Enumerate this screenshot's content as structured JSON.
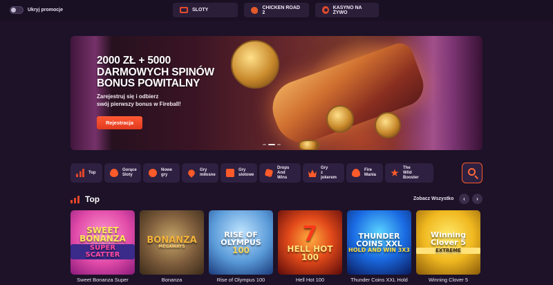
{
  "topbar": {
    "hide_promos_label": "Ukryj promocje",
    "tabs": [
      {
        "label": "SLOTY",
        "icon": "slot-machine-icon"
      },
      {
        "label": "CHICKEN ROAD 2",
        "icon": "chicken-icon"
      },
      {
        "label": "KASYNO NA ŻYWO",
        "icon": "live-casino-icon"
      }
    ]
  },
  "hero": {
    "title_line1": "2000 ZŁ + 5000",
    "title_line2": "DARMOWYCH SPINÓW",
    "title_line3": "BONUS POWITALNY",
    "subtitle_line1": "Zarejestruj się i odbierz",
    "subtitle_line2": "swój pierwszy bonus w Fireball!",
    "cta_label": "Rejestracja",
    "slides_total": 3,
    "active_slide": 2
  },
  "categories": [
    {
      "line1": "Top",
      "line2": "",
      "icon": "chart-bars-icon"
    },
    {
      "line1": "Gorące",
      "line2": "Sloty",
      "icon": "flame-icon"
    },
    {
      "line1": "Nowe",
      "line2": "gry",
      "icon": "new-icon"
    },
    {
      "line1": "Gry",
      "line2": "miłosne",
      "icon": "heart-icon"
    },
    {
      "line1": "Gry",
      "line2": "slotowe",
      "icon": "slot-icon"
    },
    {
      "line1": "Drops",
      "line2": "And Wins",
      "icon": "dice-icon"
    },
    {
      "line1": "Gry",
      "line2": "z jokerem",
      "icon": "crown-icon"
    },
    {
      "line1": "Fire",
      "line2": "Mania",
      "icon": "fire-icon"
    },
    {
      "line1": "The",
      "line2": "Wild Booster",
      "icon": "star-icon"
    }
  ],
  "top_section": {
    "title": "Top",
    "see_all_label": "Zobacz Wszystko",
    "prev_label": "‹",
    "next_label": "›"
  },
  "games": [
    {
      "name": "Sweet Bonanza Super",
      "art_main": "SWEET BONANZA",
      "art_sub": "SUPER SCATTER"
    },
    {
      "name": "Bonanza",
      "art_main": "BONANZA",
      "art_sub": "MEGAWAYS"
    },
    {
      "name": "Rise of Olympus 100",
      "art_main": "RISE OF OLYMPUS",
      "art_sub": "100"
    },
    {
      "name": "Hell Hot 100",
      "art_main": "HELL HOT 100",
      "art_sub": "7"
    },
    {
      "name": "Thunder Coins XXL Hold",
      "art_main": "THUNDER COINS XXL",
      "art_sub": "HOLD AND WIN 3X3"
    },
    {
      "name": "Winning Clover 5",
      "art_main": "Winning Clover 5",
      "art_sub": "EXTREME"
    }
  ],
  "colors": {
    "background": "#1d1228",
    "accent": "#ff5a2a",
    "card": "#2e2040"
  }
}
